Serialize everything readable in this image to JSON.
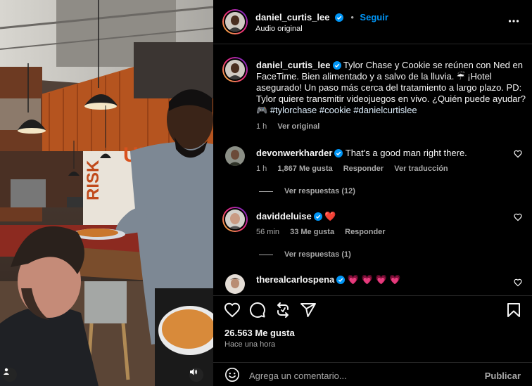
{
  "post": {
    "username": "daniel_curtis_lee",
    "follow_label": "Seguir",
    "dot": "•",
    "audio": "Audio original"
  },
  "caption": {
    "username": "daniel_curtis_lee",
    "line1": "Tylor Chase y Cookie se reúnen con Ned en",
    "line2": "FaceTime. Bien alimentado y a salvo de la lluvia. ☔ ¡Hotel",
    "line3": "asegurado! Un paso más cerca del tratamiento a largo plazo. PD:",
    "line4": "Tylor quiere transmitir videojuegos en vivo. ¿Quién puede ayudar?",
    "line5_emoji": "🎮",
    "line5_tags": "#tylorchase #cookie #danielcurtislee",
    "time": "1 h",
    "see_original": "Ver original"
  },
  "comments": [
    {
      "username": "devonwerkharder",
      "text": "That's a good man right there.",
      "time": "1 h",
      "likes": "1,867 Me gusta",
      "reply": "Responder",
      "translate": "Ver traducción",
      "view_replies": "Ver respuestas (12)"
    },
    {
      "username": "daviddeluise",
      "text": "❤️",
      "time": "56 min",
      "likes": "33 Me gusta",
      "reply": "Responder",
      "view_replies": "Ver respuestas (1)"
    },
    {
      "username": "therealcarlospena",
      "text": "💗 💗 💗 💗"
    }
  ],
  "stats": {
    "likes": "26.563 Me gusta",
    "posted": "Hace una hora"
  },
  "composer": {
    "placeholder": "Agrega un comentario...",
    "publish": "Publicar"
  },
  "colors": {
    "accent": "#0095f6",
    "verified": "#0095f6",
    "background": "#000000",
    "secondary_text": "#a8a8a8"
  },
  "icons": [
    "heart-icon",
    "comment-icon",
    "share-icon",
    "send-icon",
    "bookmark-icon",
    "more-icon",
    "verified-icon",
    "emoji-icon",
    "user-icon",
    "sound-icon"
  ]
}
